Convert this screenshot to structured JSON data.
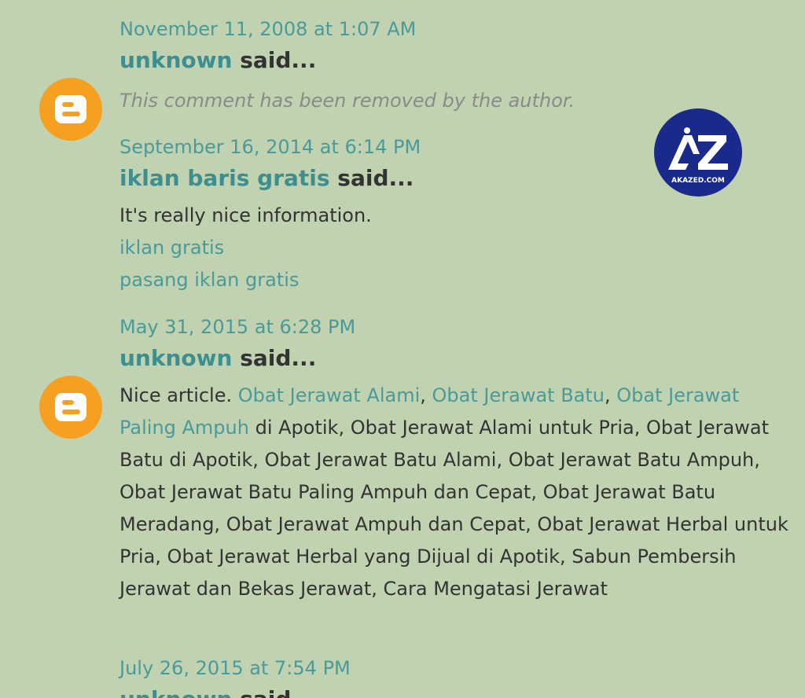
{
  "colors": {
    "background": "#c0d2b0",
    "link": "#4a9a9a",
    "author_link": "#3d8f8f",
    "text": "#333333",
    "removed_text": "#8a8a8a",
    "avatar_orange": "#f5a020",
    "watermark_blue": "#1a2a8a"
  },
  "watermark": {
    "icon": "akazed-logo",
    "mark": "AZ",
    "text": "AKAZED.COM"
  },
  "comments": [
    {
      "date": "November 11, 2008 at 1:07 AM",
      "author": "unknown",
      "said": "said...",
      "avatar": "blogger-icon",
      "removed": "This comment has been removed by the author."
    },
    {
      "date": "September 16, 2014 at 6:14 PM",
      "author": "iklan baris gratis",
      "said": "said...",
      "text": "It's really nice information.",
      "links": [
        "iklan gratis",
        "pasang iklan gratis"
      ]
    },
    {
      "date": "May 31, 2015 at 6:28 PM",
      "author": "unknown",
      "said": "said...",
      "avatar": "blogger-icon",
      "intro": "Nice article. ",
      "link1": "Obat Jerawat Alami",
      "sep1": ", ",
      "link2": "Obat Jerawat Batu",
      "sep2": ", ",
      "link3": "Obat Jerawat Paling Ampuh",
      "rest": " di Apotik, Obat Jerawat Alami untuk Pria, Obat Jerawat Batu di Apotik, Obat Jerawat Batu Alami, Obat Jerawat Batu Ampuh, Obat Jerawat Batu Paling Ampuh dan Cepat, Obat Jerawat Batu Meradang, Obat Jerawat Ampuh dan Cepat, Obat Jerawat Herbal untuk Pria, Obat Jerawat Herbal yang Dijual di Apotik, Sabun Pembersih Jerawat dan Bekas Jerawat, Cara Mengatasi Jerawat"
    },
    {
      "date": "July 26, 2015 at 7:54 PM",
      "author": "unknown",
      "said": "said..."
    }
  ]
}
